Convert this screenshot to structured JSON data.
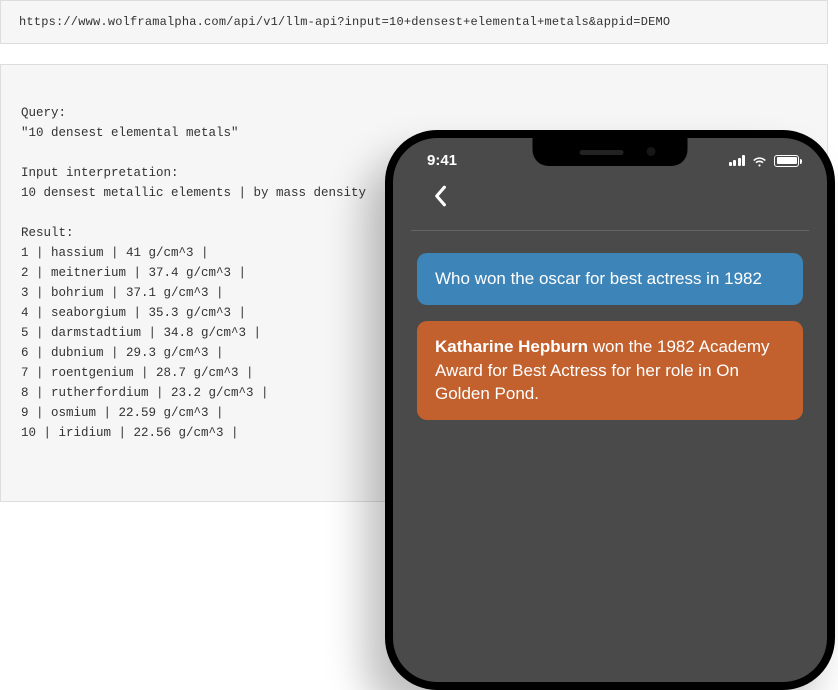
{
  "url": "https://www.wolframalpha.com/api/v1/llm-api?input=10+densest+elemental+metals&appid=DEMO",
  "api_output": {
    "query_label": "Query:",
    "query": "\"10 densest elemental metals\"",
    "interp_label": "Input interpretation:",
    "interp": "10 densest metallic elements | by mass density",
    "result_label": "Result:",
    "rows": [
      "1 | hassium | 41 g/cm^3 |",
      "2 | meitnerium | 37.4 g/cm^3 |",
      "3 | bohrium | 37.1 g/cm^3 |",
      "4 | seaborgium | 35.3 g/cm^3 |",
      "5 | darmstadtium | 34.8 g/cm^3 |",
      "6 | dubnium | 29.3 g/cm^3 |",
      "7 | roentgenium | 28.7 g/cm^3 |",
      "8 | rutherfordium | 23.2 g/cm^3 |",
      "9 | osmium | 22.59 g/cm^3 |",
      "10 | iridium | 22.56 g/cm^3 |"
    ]
  },
  "phone": {
    "time": "9:41",
    "signal_bars": 4,
    "user_message": "Who won the oscar for best actress in 1982",
    "reply_bold": "Katharine Hepburn",
    "reply_rest": " won the 1982 Academy Award for Best Actress for her role in On Golden Pond."
  }
}
